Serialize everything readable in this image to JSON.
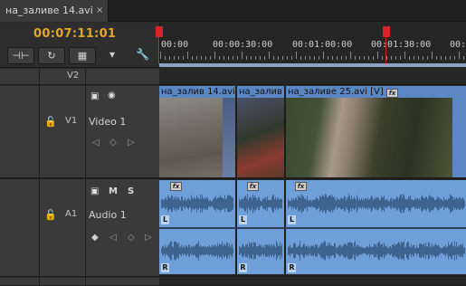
{
  "tab": {
    "title": "на_заливе 14.avi",
    "close": "×"
  },
  "timecode": "00:07:11:01",
  "toolbar": {
    "snap": "⊣⊢",
    "linked": "↻",
    "add_marker": "▦",
    "marker_down": "▾",
    "settings": "🔧"
  },
  "ruler": {
    "labels": [
      "00:00",
      "00:00:30:00",
      "00:01:00:00",
      "00:01:30:00",
      "00:02"
    ]
  },
  "tracks": {
    "v2": {
      "label": "V2"
    },
    "v1": {
      "label": "V1",
      "name": "Video 1",
      "lock": "🔓"
    },
    "a1": {
      "label": "A1",
      "name": "Audio 1",
      "lock": "🔓",
      "m": "M",
      "s": "S"
    }
  },
  "clips": {
    "video": [
      {
        "label": "на_залив 14.avi"
      },
      {
        "label": "на_залив"
      },
      {
        "label": "на_заливе 25.avi [V]"
      }
    ],
    "fx": "fx",
    "channels": {
      "left": "L",
      "right": "R"
    }
  },
  "colors": {
    "accent": "#e2a62b",
    "video_clip": "#5b87c4",
    "audio_clip": "#6f9fd8",
    "marker": "#d8232a"
  }
}
